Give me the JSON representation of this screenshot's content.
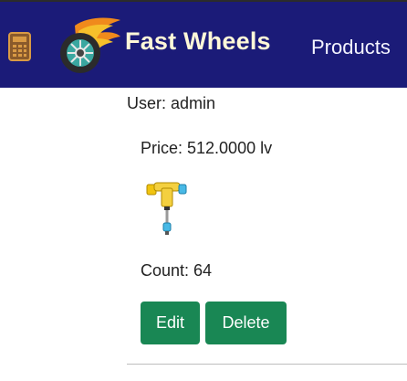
{
  "navbar": {
    "brand": "Fast Wheels",
    "products_link": "Products",
    "icons": [
      "calculator-icon",
      "flaming-wheel-logo"
    ],
    "background": "#1b1b78"
  },
  "main": {
    "user_line": "User: admin",
    "price_text": "Price: 512.0000 lv",
    "product_image": "skate-tool-image",
    "count_text": "Count: 64",
    "edit_label": "Edit",
    "delete_label": "Delete",
    "button_color": "#198754"
  }
}
